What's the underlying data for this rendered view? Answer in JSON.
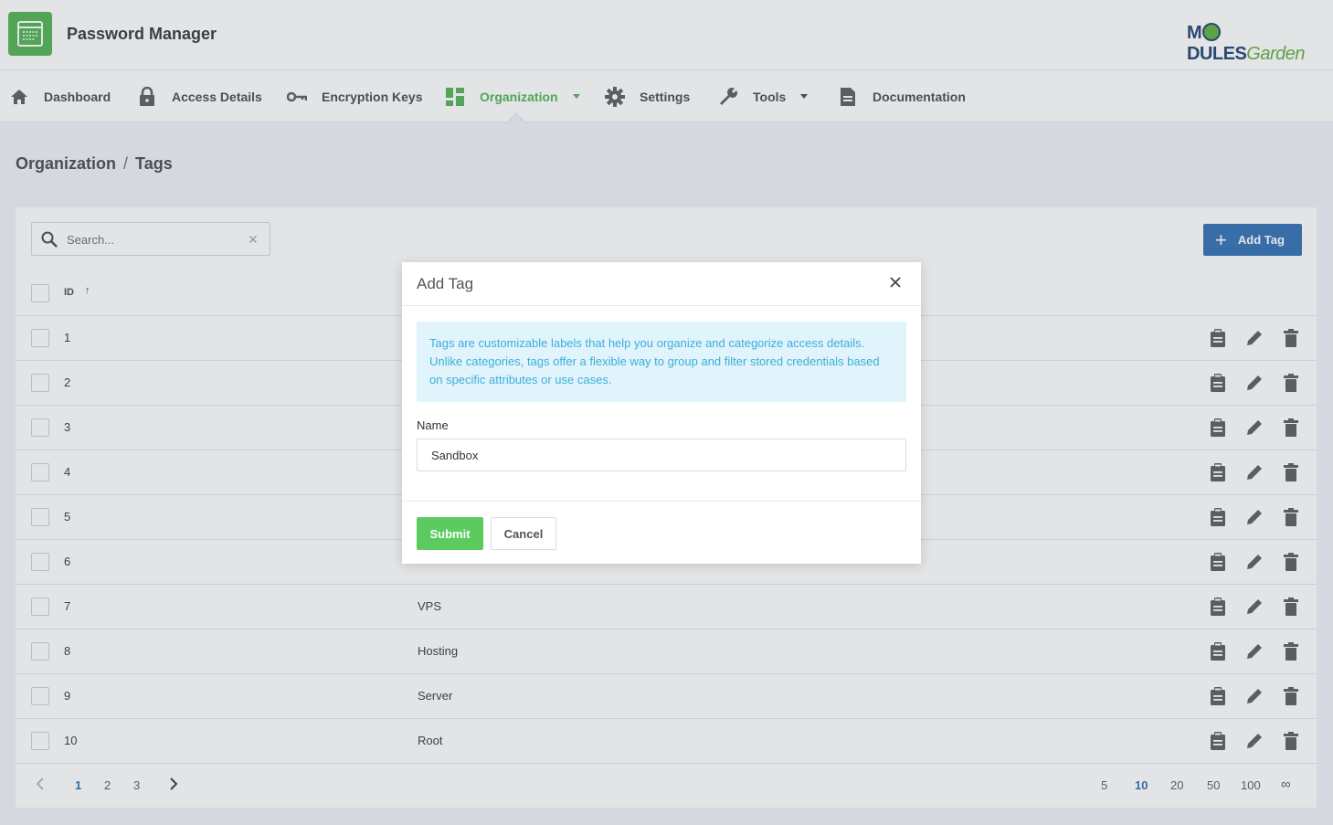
{
  "app": {
    "title": "Password Manager",
    "logo_main": "MODULES",
    "logo_accent": "Garden"
  },
  "nav": {
    "items": [
      {
        "label": "Dashboard",
        "icon": "home-icon"
      },
      {
        "label": "Access Details",
        "icon": "lock-icon"
      },
      {
        "label": "Encryption Keys",
        "icon": "key-icon"
      },
      {
        "label": "Organization",
        "icon": "dashboard-grid-icon",
        "active": true,
        "dropdown": true
      },
      {
        "label": "Settings",
        "icon": "gear-icon"
      },
      {
        "label": "Tools",
        "icon": "wrench-icon",
        "dropdown": true
      },
      {
        "label": "Documentation",
        "icon": "document-icon"
      }
    ]
  },
  "breadcrumb": {
    "parent": "Organization",
    "separator": "/",
    "current": "Tags"
  },
  "toolbar": {
    "search_placeholder": "Search...",
    "add_label": "Add Tag"
  },
  "table": {
    "id_header": "ID",
    "sort_indicator": "↑",
    "rows": [
      {
        "id": "1",
        "name": ""
      },
      {
        "id": "2",
        "name": ""
      },
      {
        "id": "3",
        "name": ""
      },
      {
        "id": "4",
        "name": ""
      },
      {
        "id": "5",
        "name": ""
      },
      {
        "id": "6",
        "name": ""
      },
      {
        "id": "7",
        "name": "VPS"
      },
      {
        "id": "8",
        "name": "Hosting"
      },
      {
        "id": "9",
        "name": "Server"
      },
      {
        "id": "10",
        "name": "Root"
      }
    ]
  },
  "pagination": {
    "pages": [
      "1",
      "2",
      "3"
    ],
    "current_page": "1",
    "page_sizes": [
      "5",
      "10",
      "20",
      "50",
      "100",
      "∞"
    ],
    "current_size": "10"
  },
  "modal": {
    "title": "Add Tag",
    "info": "Tags are customizable labels that help you organize and categorize access details. Unlike categories, tags offer a flexible way to group and filter stored credentials based on specific attributes or use cases.",
    "name_label": "Name",
    "name_value": "Sandbox",
    "submit_label": "Submit",
    "cancel_label": "Cancel"
  },
  "colors": {
    "brand_green": "#5cb85c",
    "primary_blue": "#3f78b8",
    "info_text": "#3ab0dc",
    "info_bg": "#e1f3fb"
  }
}
